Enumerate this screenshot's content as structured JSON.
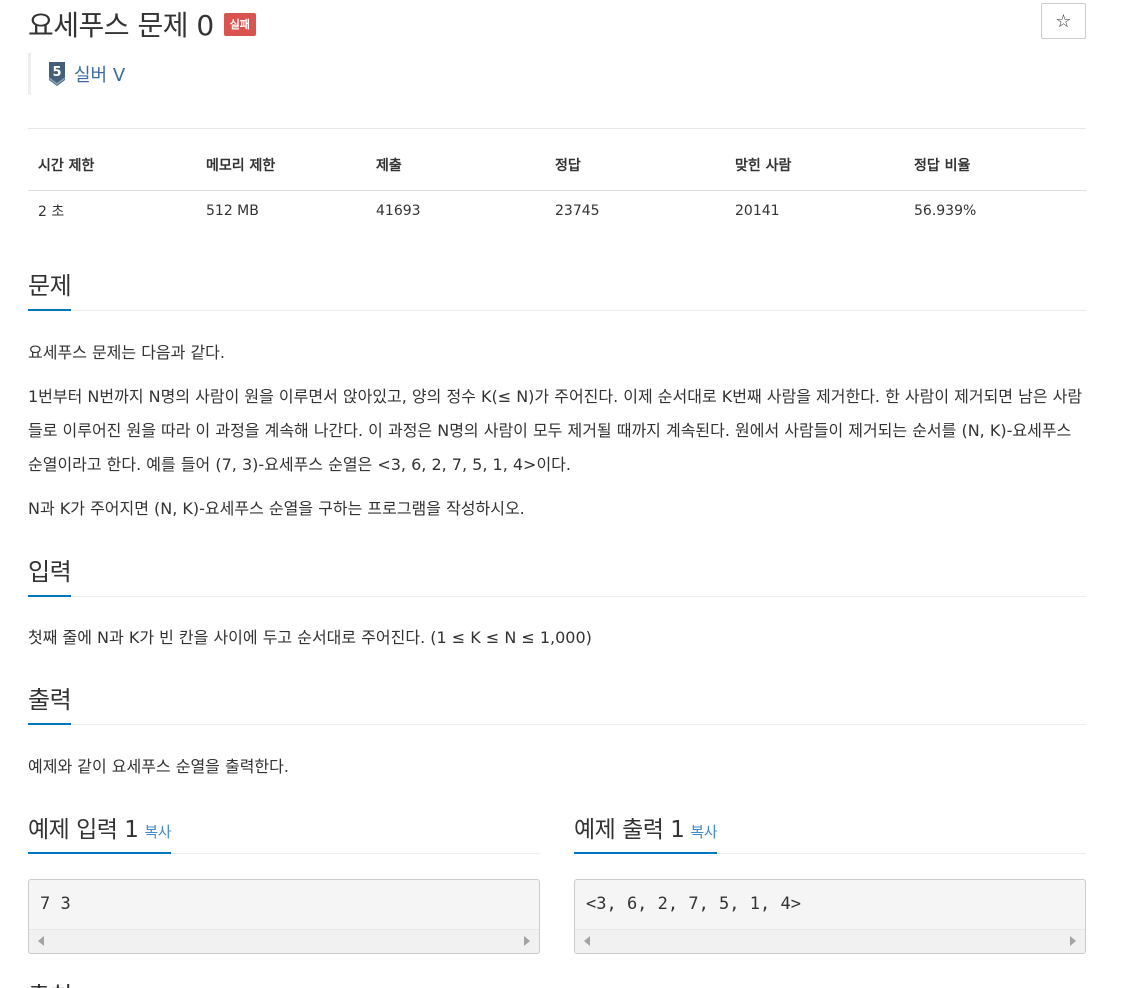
{
  "problem": {
    "title": "요세푸스 문제 0",
    "result_badge": "실패",
    "star_label": "☆",
    "tier_number": "5",
    "tier_label": "실버 V"
  },
  "info_table": {
    "headers": [
      "시간 제한",
      "메모리 제한",
      "제출",
      "정답",
      "맞힌 사람",
      "정답 비율"
    ],
    "values": [
      "2 초",
      "512 MB",
      "41693",
      "23745",
      "20141",
      "56.939%"
    ]
  },
  "sections": {
    "problem_title": "문제",
    "problem_paragraphs": [
      "요세푸스 문제는 다음과 같다.",
      "1번부터 N번까지 N명의 사람이 원을 이루면서 앉아있고, 양의 정수 K(≤ N)가 주어진다. 이제 순서대로 K번째 사람을 제거한다. 한 사람이 제거되면 남은 사람들로 이루어진 원을 따라 이 과정을 계속해 나간다. 이 과정은 N명의 사람이 모두 제거될 때까지 계속된다. 원에서 사람들이 제거되는 순서를 (N, K)-요세푸스 순열이라고 한다. 예를 들어 (7, 3)-요세푸스 순열은 <3, 6, 2, 7, 5, 1, 4>이다.",
      "N과 K가 주어지면 (N, K)-요세푸스 순열을 구하는 프로그램을 작성하시오."
    ],
    "input_title": "입력",
    "input_text": "첫째 줄에 N과 K가 빈 칸을 사이에 두고 순서대로 주어진다. (1 ≤ K ≤ N ≤ 1,000)",
    "output_title": "출력",
    "output_text": "예제와 같이 요세푸스 순열을 출력한다.",
    "next_title_partial": "출처"
  },
  "samples": {
    "input_title": "예제 입력 1",
    "output_title": "예제 출력 1",
    "copy_label": "복사",
    "input_value": "7 3",
    "output_value": "<3, 6, 2, 7, 5, 1, 4>"
  },
  "colors": {
    "badge_fail": "#d9534f",
    "accent_underline": "#0076c0",
    "tier_text": "#3c6c9e",
    "link": "#428bca"
  }
}
